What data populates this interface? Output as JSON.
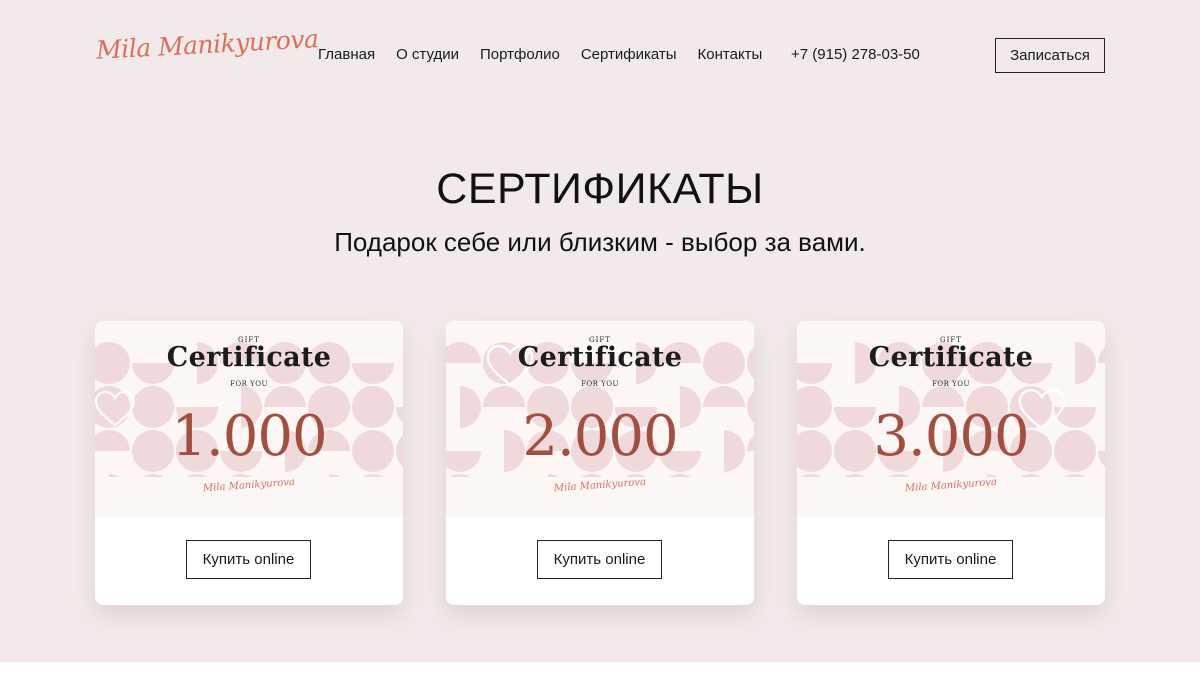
{
  "header": {
    "logo": "Mila Manikyurova",
    "nav": [
      "Главная",
      "О студии",
      "Портфолио",
      "Сертификаты",
      "Контакты"
    ],
    "phone": "+7 (915) 278-03-50",
    "signup_label": "Записаться"
  },
  "section": {
    "title": "СЕРТИФИКАТЫ",
    "subtitle": "Подарок себе или близким - выбор за вами."
  },
  "cards": [
    {
      "gift": "GIFT",
      "heading": "Certificate",
      "for_you": "FOR YOU",
      "amount": "1.000",
      "logo": "Mila Manikyurova",
      "button": "Купить online"
    },
    {
      "gift": "GIFT",
      "heading": "Certificate",
      "for_you": "FOR YOU",
      "amount": "2.000",
      "logo": "Mila Manikyurova",
      "button": "Купить online"
    },
    {
      "gift": "GIFT",
      "heading": "Certificate",
      "for_you": "FOR YOU",
      "amount": "3.000",
      "logo": "Mila Manikyurova",
      "button": "Купить online"
    }
  ],
  "colors": {
    "page_bg": "#f2eaea",
    "brand": "#d9705e",
    "amount": "#a14f41",
    "pattern": "#efd9da"
  },
  "icons": [
    "heart-outline-icon"
  ]
}
